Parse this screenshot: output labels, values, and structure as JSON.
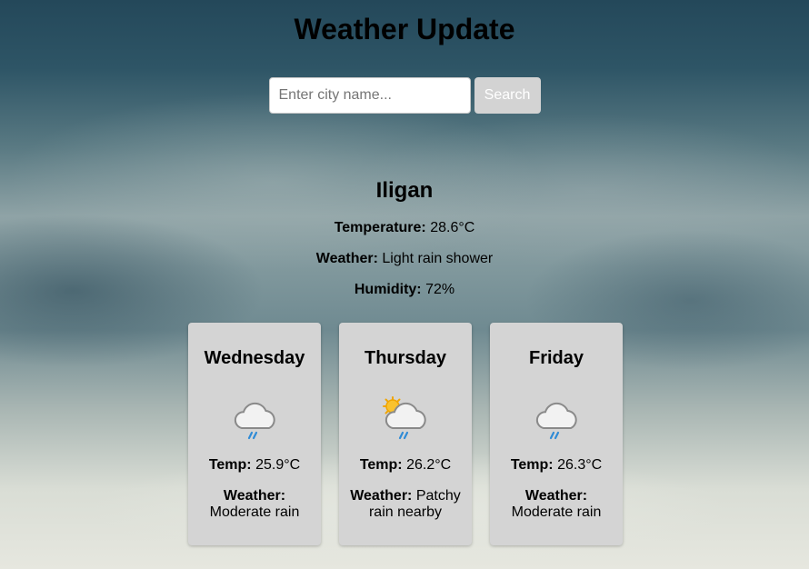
{
  "header": {
    "title": "Weather Update"
  },
  "search": {
    "placeholder": "Enter city name...",
    "value": "",
    "button_label": "Search"
  },
  "current": {
    "city": "Iligan",
    "temperature_label": "Temperature:",
    "temperature": "28.6°C",
    "weather_label": "Weather:",
    "weather": "Light rain shower",
    "humidity_label": "Humidity:",
    "humidity": "72%"
  },
  "forecast": [
    {
      "day": "Wednesday",
      "icon": "rain-cloud-icon",
      "temp_label": "Temp:",
      "temp": "25.9°C",
      "weather_label": "Weather:",
      "weather": "Moderate rain"
    },
    {
      "day": "Thursday",
      "icon": "sun-rain-cloud-icon",
      "temp_label": "Temp:",
      "temp": "26.2°C",
      "weather_label": "Weather:",
      "weather": "Patchy rain nearby"
    },
    {
      "day": "Friday",
      "icon": "rain-cloud-icon",
      "temp_label": "Temp:",
      "temp": "26.3°C",
      "weather_label": "Weather:",
      "weather": "Moderate rain"
    }
  ]
}
